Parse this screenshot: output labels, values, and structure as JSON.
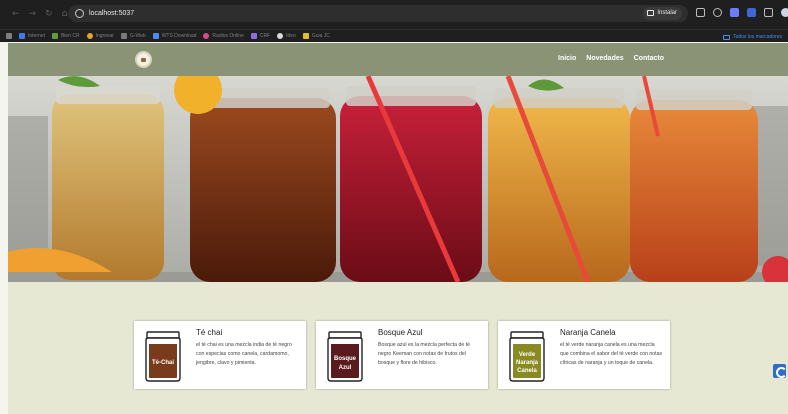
{
  "browser": {
    "url": "localhost:5037",
    "install_label": "Instalar",
    "bookmarks": [
      {
        "label": "Internet",
        "color": "#3f7be0"
      },
      {
        "label": "Bien CR",
        "color": "#5aa043"
      },
      {
        "label": "Ingresar",
        "color": "#e0a52a"
      },
      {
        "label": "G-Web",
        "color": "#7a7a7a"
      },
      {
        "label": "WTS Download",
        "color": "#4a8cf0"
      },
      {
        "label": "Radios Online",
        "color": "#d64c8e"
      },
      {
        "label": "CRF",
        "color": "#8c6ce0"
      },
      {
        "label": "Ideo",
        "color": "#d9d9d9"
      },
      {
        "label": "Guia JC",
        "color": "#e0c02a"
      }
    ],
    "all_bookmarks_label": "Todos los marcadores"
  },
  "nav": {
    "links": [
      "Inicio",
      "Novedades",
      "Contacto"
    ]
  },
  "cards": [
    {
      "title": "Té chai",
      "jar_label": "Té-Chai",
      "description": "el té chai es una mezcla india de té negro con especias como canela, cardamomo, jengibre, clavo y pimienta.",
      "tea_color": "#7a3a1c"
    },
    {
      "title": "Bosque Azul",
      "jar_label_lines": [
        "Bosque",
        "Azul"
      ],
      "description": "Bosque azul es la mezcla perfecta de té negro Keeman con notas de frutos del bosque y flore de hibisco.",
      "tea_color": "#5a1a1e"
    },
    {
      "title": "Naranja Canela",
      "jar_label_lines": [
        "Verde",
        "Naranja",
        "Canela"
      ],
      "description": "el té verde naranja canela es una mezcla que combina el sabor del té verde con notas cítricas de naranja y un toque de canela.",
      "tea_color": "#8a8a22"
    }
  ]
}
